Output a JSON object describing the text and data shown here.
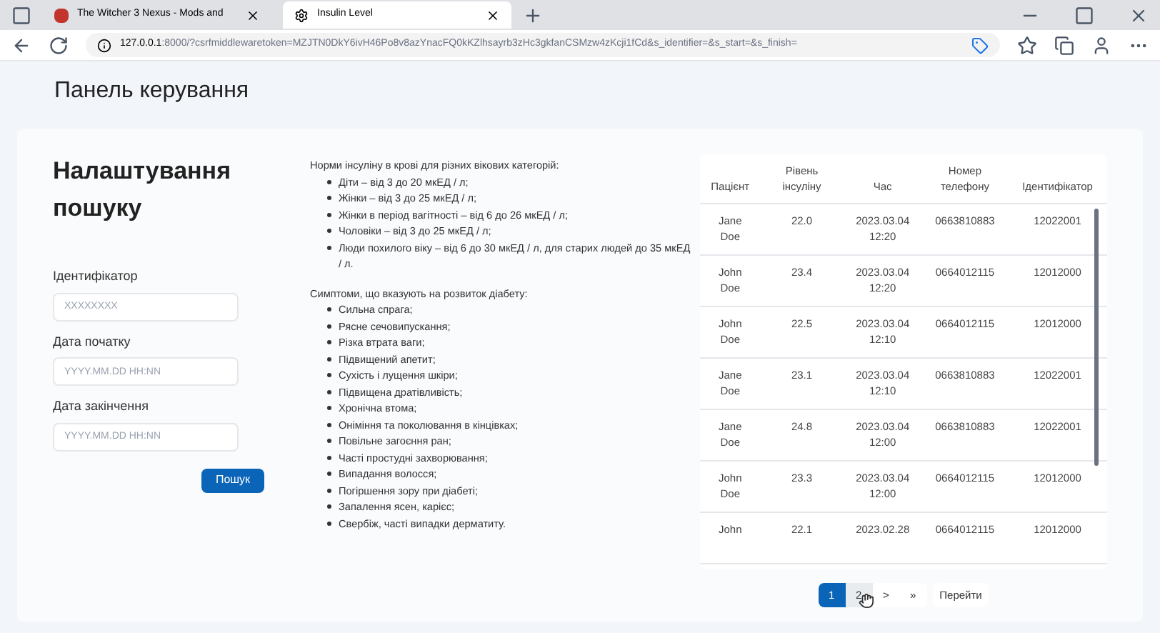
{
  "browser": {
    "tabs": [
      {
        "title": "The Witcher 3 Nexus - Mods and",
        "selected": false
      },
      {
        "title": "Insulin Level",
        "selected": true
      }
    ],
    "url_host": "127.0.0.1",
    "url_rest": ":8000/?csrfmiddlewaretoken=MZJTN0DkY6ivH46Po8v8azYnacFQ0kKZlhsayrb3zHc3gkfanCSMzw4zKcji1fCd&s_identifier=&s_start=&s_finish="
  },
  "page": {
    "title": "Панель керування"
  },
  "search": {
    "title": "Налаштування пошуку",
    "fields": [
      {
        "label": "Ідентифікатор",
        "placeholder": "XXXXXXXX"
      },
      {
        "label": "Дата початку",
        "placeholder": "YYYY.MM.DD HH:NN"
      },
      {
        "label": "Дата закінчення",
        "placeholder": "YYYY.MM.DD HH:NN"
      }
    ],
    "button": "Пошук"
  },
  "info": [
    {
      "heading": "Норми інсуліну в крові для різних вікових категорій:",
      "items": [
        "Діти – від 3 до 20 мкЕД / л;",
        "Жінки – від 3 до 25 мкЕД / л;",
        "Жінки в період вагітності – від 6 до 26 мкЕД / л;",
        "Чоловіки – від 3 до 25 мкЕД / л;",
        "Люди похилого віку – від 6 до 30 мкЕД / л, для старих людей до 35 мкЕД / л."
      ]
    },
    {
      "heading": "Симптоми, що вказують на розвиток діабету:",
      "items": [
        "Сильна спрага;",
        "Рясне сечовипускання;",
        "Різка втрата ваги;",
        "Підвищений апетит;",
        "Сухість і лущення шкіри;",
        "Підвищена дратівливість;",
        "Хронічна втома;",
        "Оніміння та поколювання в кінцівках;",
        "Повільне загоєння ран;",
        "Часті простудні захворювання;",
        "Випадання волосся;",
        "Погіршення зору при діабеті;",
        "Запалення ясен, карієс;",
        "Свербіж, часті випадки дерматиту."
      ]
    }
  ],
  "table": {
    "columns": [
      "Пацієнт",
      "Рівень інсуліну",
      "Час",
      "Номер телефону",
      "Ідентифікатор"
    ],
    "rows": [
      {
        "patient": "Jane Doe",
        "level": "22.0",
        "date": "2023.03.04",
        "time": "12:20",
        "phone": "0663810883",
        "id": "12022001"
      },
      {
        "patient": "John Doe",
        "level": "23.4",
        "date": "2023.03.04",
        "time": "12:20",
        "phone": "0664012115",
        "id": "12012000"
      },
      {
        "patient": "John Doe",
        "level": "22.5",
        "date": "2023.03.04",
        "time": "12:10",
        "phone": "0664012115",
        "id": "12012000"
      },
      {
        "patient": "Jane Doe",
        "level": "23.1",
        "date": "2023.03.04",
        "time": "12:10",
        "phone": "0663810883",
        "id": "12022001"
      },
      {
        "patient": "Jane Doe",
        "level": "24.8",
        "date": "2023.03.04",
        "time": "12:00",
        "phone": "0663810883",
        "id": "12022001"
      },
      {
        "patient": "John Doe",
        "level": "23.3",
        "date": "2023.03.04",
        "time": "12:00",
        "phone": "0664012115",
        "id": "12012000"
      },
      {
        "patient": "John",
        "level": "22.1",
        "date": "2023.02.28",
        "phone": "0664012115",
        "id": "12012000"
      }
    ]
  },
  "pagination": {
    "pages": [
      {
        "label": "1",
        "selected": true
      },
      {
        "label": "2",
        "selected": false
      }
    ],
    "next": ">",
    "last": "»",
    "go": "Перейти"
  }
}
